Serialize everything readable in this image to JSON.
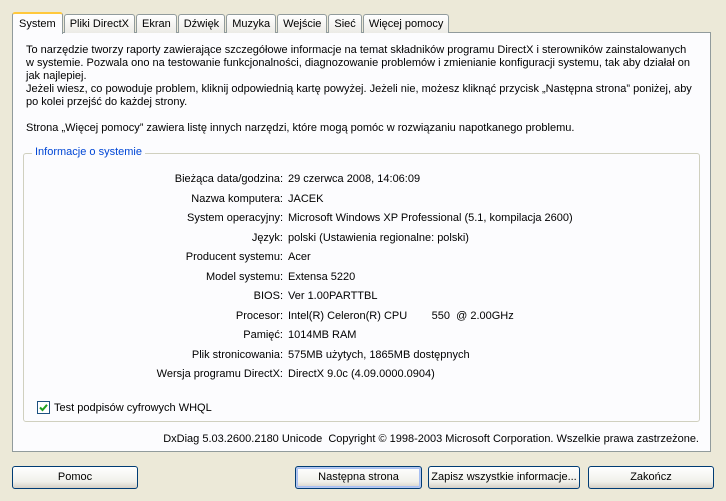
{
  "tabs": [
    {
      "label": "System",
      "active": true
    },
    {
      "label": "Pliki DirectX",
      "active": false
    },
    {
      "label": "Ekran",
      "active": false
    },
    {
      "label": "Dźwięk",
      "active": false
    },
    {
      "label": "Muzyka",
      "active": false
    },
    {
      "label": "Wejście",
      "active": false
    },
    {
      "label": "Sieć",
      "active": false
    },
    {
      "label": "Więcej pomocy",
      "active": false
    }
  ],
  "intro": {
    "paragraph1": "To narzędzie tworzy raporty zawierające szczegółowe informacje na temat składników programu DirectX i sterowników zainstalowanych w systemie. Pozwala ono na testowanie funkcjonalności, diagnozowanie problemów i zmienianie konfiguracji systemu, tak aby działał on jak najlepiej.",
    "paragraph2": "Jeżeli wiesz, co powoduje problem, kliknij odpowiednią kartę powyżej. Jeżeli nie, możesz kliknąć przycisk „Następna strona” poniżej, aby po kolei przejść do każdej strony.",
    "paragraph3": "Strona „Więcej pomocy” zawiera listę innych narzędzi, które mogą pomóc w rozwiązaniu napotkanego problemu."
  },
  "system_info": {
    "title": "Informacje o systemie",
    "rows": [
      {
        "label": "Bieżąca data/godzina:",
        "value": "29 czerwca 2008, 14:06:09"
      },
      {
        "label": "Nazwa komputera:",
        "value": "JACEK"
      },
      {
        "label": "System operacyjny:",
        "value": "Microsoft Windows XP Professional (5.1, kompilacja 2600)"
      },
      {
        "label": "Język:",
        "value": "polski (Ustawienia regionalne: polski)"
      },
      {
        "label": "Producent systemu:",
        "value": "Acer"
      },
      {
        "label": "Model systemu:",
        "value": "Extensa 5220"
      },
      {
        "label": "BIOS:",
        "value": "Ver 1.00PARTTBL"
      },
      {
        "label": "Procesor:",
        "value": "Intel(R) Celeron(R) CPU        550  @ 2.00GHz"
      },
      {
        "label": "Pamięć:",
        "value": "1014MB RAM"
      },
      {
        "label": "Plik stronicowania:",
        "value": "575MB użytych, 1865MB dostępnych"
      },
      {
        "label": "Wersja programu DirectX:",
        "value": "DirectX 9.0c (4.09.0000.0904)"
      }
    ]
  },
  "whql_checkbox": {
    "label": "Test podpisów cyfrowych WHQL",
    "checked": true
  },
  "footer": "DxDiag 5.03.2600.2180 Unicode  Copyright © 1998-2003 Microsoft Corporation. Wszelkie prawa zastrzeżone.",
  "buttons": {
    "help": "Pomoc",
    "next": "Następna strona",
    "save": "Zapisz wszystkie informacje...",
    "close": "Zakończ"
  },
  "colors": {
    "window_bg": "#ece9d8",
    "panel_bg": "#fcfcfe",
    "group_title": "#0046d5",
    "active_tab_accent": "#ffc83c"
  },
  "icons": {
    "checkmark": "check-icon"
  }
}
